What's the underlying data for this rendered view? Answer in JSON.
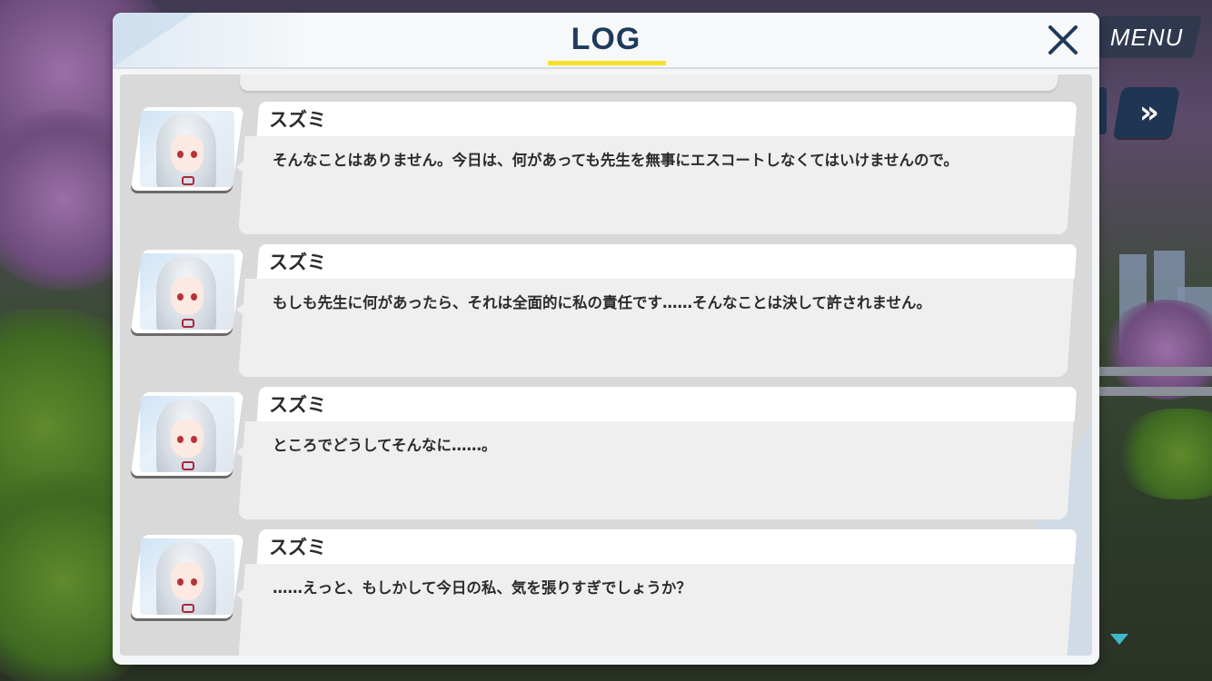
{
  "menu": {
    "label": "MENU"
  },
  "log": {
    "title": "LOG",
    "entries": [
      {
        "speaker": "スズミ",
        "text": "そんなことはありません。今日は、何があっても先生を無事にエスコートしなくてはいけませんので。"
      },
      {
        "speaker": "スズミ",
        "text": "もしも先生に何があったら、それは全面的に私の責任です……そんなことは決して許されません。"
      },
      {
        "speaker": "スズミ",
        "text": "ところでどうしてそんなに……。"
      },
      {
        "speaker": "スズミ",
        "text": "……えっと、もしかして今日の私、気を張りすぎでしょうか？"
      }
    ]
  },
  "colors": {
    "title": "#1e3a5c",
    "title_underline": "#f5e12a",
    "panel": "#f3f5f7",
    "body": "#d9d9d9",
    "bubble": "#efefef",
    "scroll_arrow": "#3fb9c9"
  },
  "icons": {
    "close": "close-icon",
    "fast_forward": "fast-forward-icon",
    "scroll_down": "triangle-down-icon"
  }
}
